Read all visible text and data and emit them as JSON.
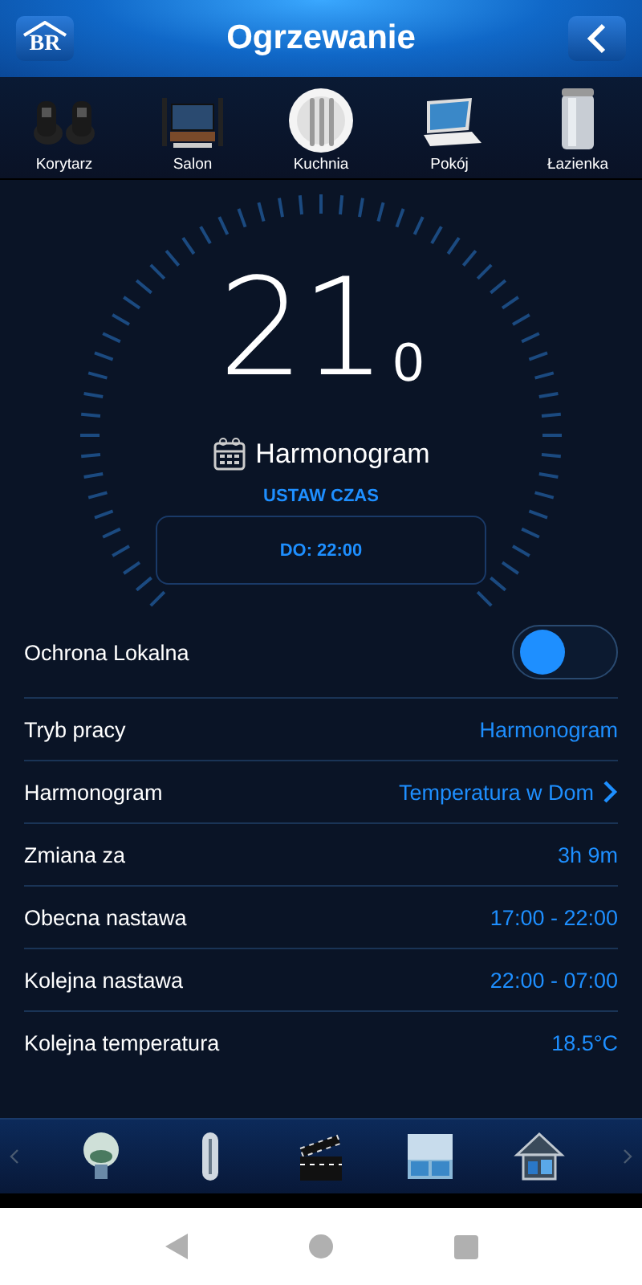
{
  "header": {
    "title": "Ogrzewanie",
    "logo": "BR"
  },
  "rooms": [
    {
      "label": "Korytarz",
      "kind": "shoes"
    },
    {
      "label": "Salon",
      "kind": "tv"
    },
    {
      "label": "Kuchnia",
      "kind": "plate"
    },
    {
      "label": "Pokój",
      "kind": "laptop"
    },
    {
      "label": "Łazienka",
      "kind": "shower"
    }
  ],
  "dial": {
    "temperature": "21",
    "decimal": "0",
    "mode": "Harmonogram",
    "set_time_label": "USTAW CZAS",
    "until_button": "DO: 22:00"
  },
  "settings": [
    {
      "label": "Ochrona Lokalna",
      "kind": "toggle",
      "on": false
    },
    {
      "label": "Tryb pracy",
      "kind": "value",
      "value": "Harmonogram"
    },
    {
      "label": "Harmonogram",
      "kind": "link",
      "value": "Temperatura w Dom"
    },
    {
      "label": "Zmiana za",
      "kind": "value",
      "value": "3h 9m"
    },
    {
      "label": "Obecna nastawa",
      "kind": "value",
      "value": "17:00 - 22:00"
    },
    {
      "label": "Kolejna nastawa",
      "kind": "value",
      "value": "22:00 - 07:00"
    },
    {
      "label": "Kolejna temperatura",
      "kind": "value",
      "value": "18.5°C"
    }
  ],
  "bottom_bar": [
    {
      "kind": "bulb"
    },
    {
      "kind": "thermometer"
    },
    {
      "kind": "clapper"
    },
    {
      "kind": "blind"
    },
    {
      "kind": "house"
    }
  ]
}
